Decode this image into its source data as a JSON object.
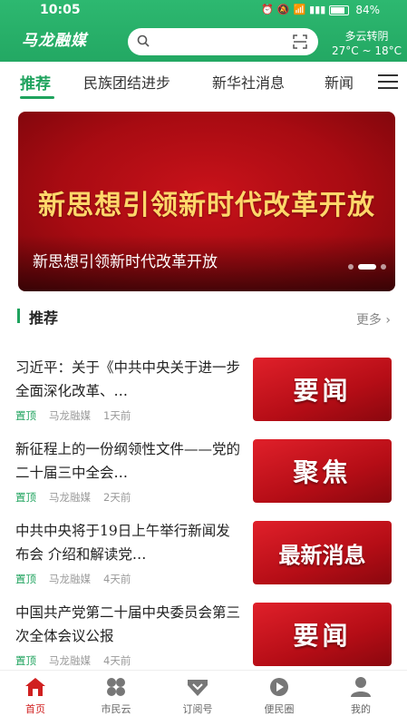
{
  "status_bar": {
    "time": "10:05",
    "battery": "84%"
  },
  "header": {
    "logo": "马龙融媒",
    "search": {
      "placeholder": ""
    },
    "weather": {
      "condition": "多云转阴",
      "temp": "27°C ~ 18°C"
    }
  },
  "tabs": [
    {
      "label": "推荐",
      "active": true
    },
    {
      "label": "民族团结进步"
    },
    {
      "label": "新华社消息"
    },
    {
      "label": "新闻"
    }
  ],
  "banner": {
    "headline": "新思想引领新时代改革开放",
    "caption": "新思想引领新时代改革开放",
    "slide_count": 3,
    "active_slide": 2
  },
  "section": {
    "title": "推荐",
    "more": "更多"
  },
  "news": [
    {
      "title": "习近平：关于《中共中央关于进一步全面深化改革、…",
      "tag": "置顶",
      "source": "马龙融媒",
      "time": "1天前",
      "thumb": "要闻"
    },
    {
      "title": "新征程上的一份纲领性文件——党的二十届三中全会…",
      "tag": "置顶",
      "source": "马龙融媒",
      "time": "2天前",
      "thumb": "聚焦"
    },
    {
      "title": "中共中央将于19日上午举行新闻发布会 介绍和解读党…",
      "tag": "置顶",
      "source": "马龙融媒",
      "time": "4天前",
      "thumb": "最新消息"
    },
    {
      "title": "中国共产党第二十届中央委员会第三次全体会议公报",
      "tag": "置顶",
      "source": "马龙融媒",
      "time": "4天前",
      "thumb": "要闻"
    }
  ],
  "bottom_nav": [
    {
      "label": "首页",
      "icon": "home-icon",
      "active": true
    },
    {
      "label": "市民云",
      "icon": "grid-icon"
    },
    {
      "label": "订阅号",
      "icon": "heart-icon"
    },
    {
      "label": "便民圈",
      "icon": "circle-icon"
    },
    {
      "label": "我的",
      "icon": "user-icon"
    }
  ],
  "colors": {
    "brand_green": "#23a863",
    "news_red": "#c8121a",
    "banner_text": "#ffd76a",
    "active_nav": "#d02020"
  }
}
